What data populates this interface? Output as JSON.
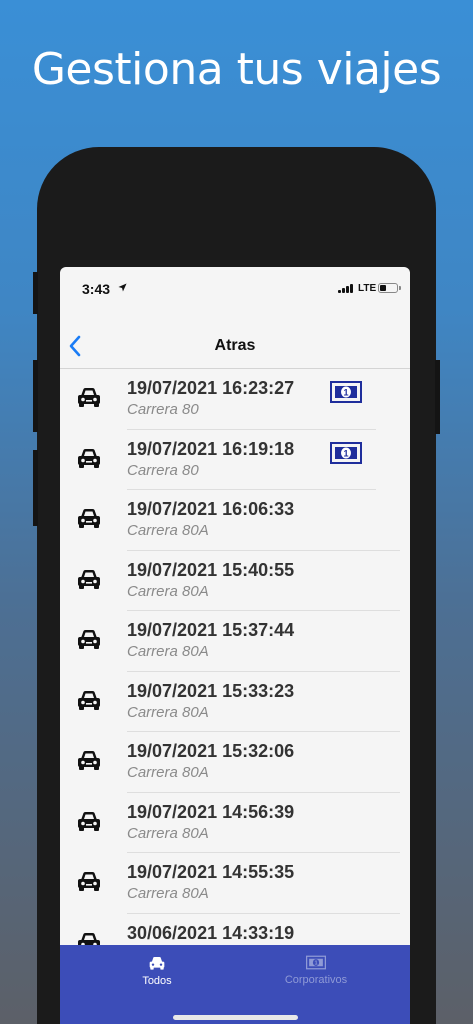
{
  "headline": "Gestiona tus viajes",
  "status_bar": {
    "time": "3:43",
    "network": "LTE",
    "battery_level": 0.4
  },
  "nav": {
    "title": "Atras",
    "back_icon": "chevron-left-icon"
  },
  "trips": [
    {
      "datetime": "19/07/2021 16:23:27",
      "address": "Carrera 80",
      "icon": "car-icon",
      "payment_icon": "cash-icon"
    },
    {
      "datetime": "19/07/2021 16:19:18",
      "address": "Carrera 80",
      "icon": "car-icon",
      "payment_icon": "cash-icon"
    },
    {
      "datetime": "19/07/2021 16:06:33",
      "address": "Carrera 80A",
      "icon": "car-icon"
    },
    {
      "datetime": "19/07/2021 15:40:55",
      "address": "Carrera 80A",
      "icon": "car-icon"
    },
    {
      "datetime": "19/07/2021 15:37:44",
      "address": "Carrera 80A",
      "icon": "car-icon"
    },
    {
      "datetime": "19/07/2021 15:33:23",
      "address": "Carrera 80A",
      "icon": "car-icon"
    },
    {
      "datetime": "19/07/2021 15:32:06",
      "address": "Carrera 80A",
      "icon": "car-icon"
    },
    {
      "datetime": "19/07/2021 14:56:39",
      "address": "Carrera 80A",
      "icon": "car-icon"
    },
    {
      "datetime": "19/07/2021 14:55:35",
      "address": "Carrera 80A",
      "icon": "car-icon"
    },
    {
      "datetime": "30/06/2021 14:33:19",
      "address": "",
      "icon": "car-icon"
    }
  ],
  "tabs": [
    {
      "label": "Todos",
      "icon": "car-icon",
      "active": true
    },
    {
      "label": "Corporativos",
      "icon": "cash-icon",
      "active": false
    }
  ],
  "colors": {
    "accent": "#1a7cf5",
    "tabbar": "#3c4db8",
    "money_icon": "#1f2e9c"
  }
}
